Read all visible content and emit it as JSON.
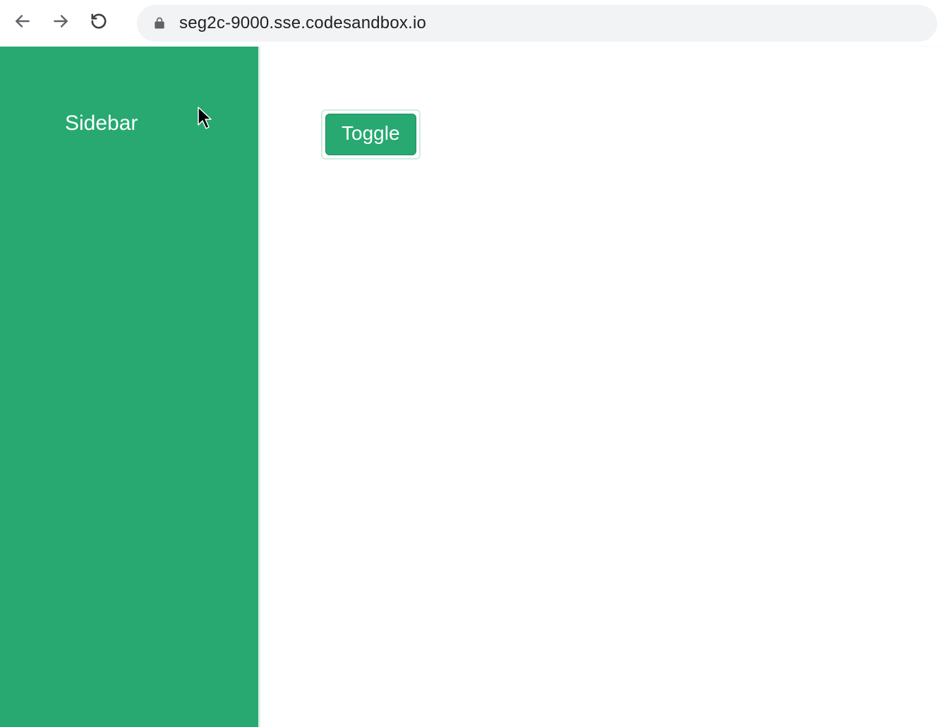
{
  "browser": {
    "url": "seg2c-9000.sse.codesandbox.io"
  },
  "sidebar": {
    "title": "Sidebar"
  },
  "main": {
    "toggle_label": "Toggle"
  },
  "colors": {
    "accent": "#27a971",
    "focus_ring": "#cdeee0"
  }
}
